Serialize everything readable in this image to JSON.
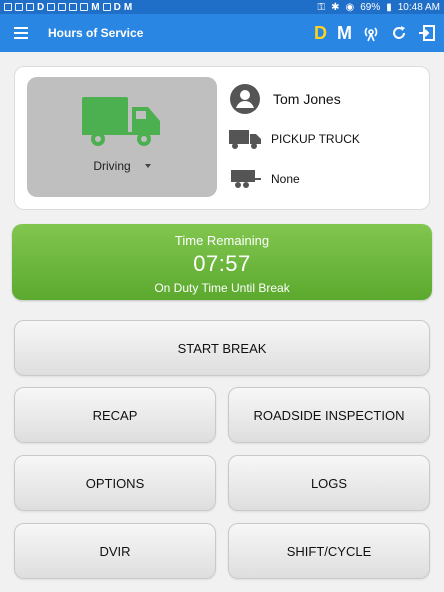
{
  "statusbar": {
    "left_letters": [
      "D",
      "M",
      "D",
      "M"
    ],
    "battery": "69%",
    "time": "10:48 AM"
  },
  "appbar": {
    "title": "Hours of Service",
    "d_label": "D",
    "m_label": "M"
  },
  "status": {
    "value": "Driving"
  },
  "driver": {
    "name": "Tom Jones",
    "vehicle": "PICKUP TRUCK",
    "trailer": "None"
  },
  "time_remaining": {
    "title": "Time Remaining",
    "value": "07:57",
    "subtitle": "On Duty Time Until Break"
  },
  "buttons": {
    "start_break": "START BREAK",
    "recap": "RECAP",
    "roadside": "ROADSIDE INSPECTION",
    "options": "OPTIONS",
    "logs": "LOGS",
    "dvir": "DVIR",
    "shift": "SHIFT/CYCLE"
  },
  "colors": {
    "appbar": "#2a86e3",
    "truck_green": "#4caf50",
    "time_card_green": "#6cb43c",
    "d_letter": "#ffd21f"
  },
  "icons": [
    "menu-icon",
    "vpn-key-icon",
    "bluetooth-icon",
    "wifi-icon",
    "battery-icon",
    "signal-icon",
    "refresh-icon",
    "logout-icon",
    "truck-icon",
    "account-icon",
    "pickup-truck-icon",
    "trailer-icon",
    "chevron-down-icon"
  ]
}
